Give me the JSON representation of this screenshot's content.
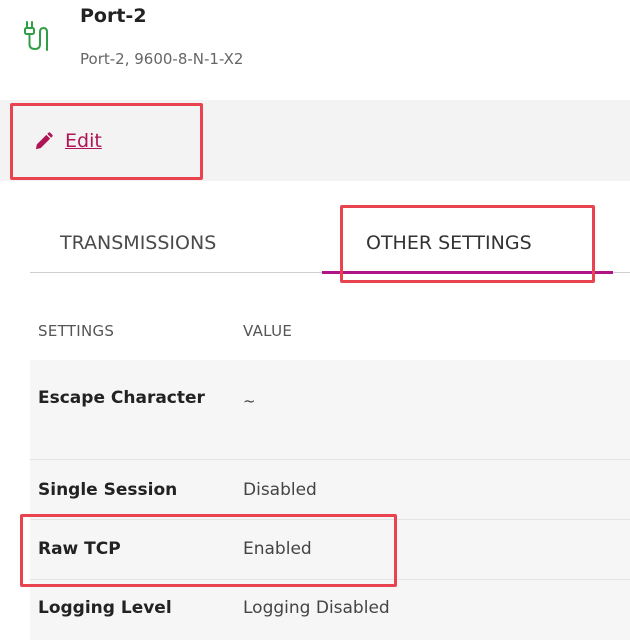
{
  "header": {
    "icon": "serial-port-icon",
    "title": "Port-2",
    "subtitle": "Port-2, 9600-8-N-1-X2"
  },
  "actions": {
    "edit_icon": "pencil-icon",
    "edit_label": "Edit"
  },
  "tabs": [
    {
      "label": "TRANSMISSIONS",
      "active": false
    },
    {
      "label": "OTHER SETTINGS",
      "active": true
    }
  ],
  "table": {
    "headers": {
      "settings": "SETTINGS",
      "value": "VALUE"
    },
    "rows": [
      {
        "label": "Escape Character",
        "value": "~"
      },
      {
        "label": "Single Session",
        "value": "Disabled"
      },
      {
        "label": "Raw TCP",
        "value": "Enabled"
      },
      {
        "label": "Logging Level",
        "value": "Logging Disabled"
      }
    ]
  },
  "colors": {
    "accent": "#b01454",
    "tab_active": "#b01486",
    "highlight": "#e8434f",
    "icon_green": "#2f9e44"
  }
}
